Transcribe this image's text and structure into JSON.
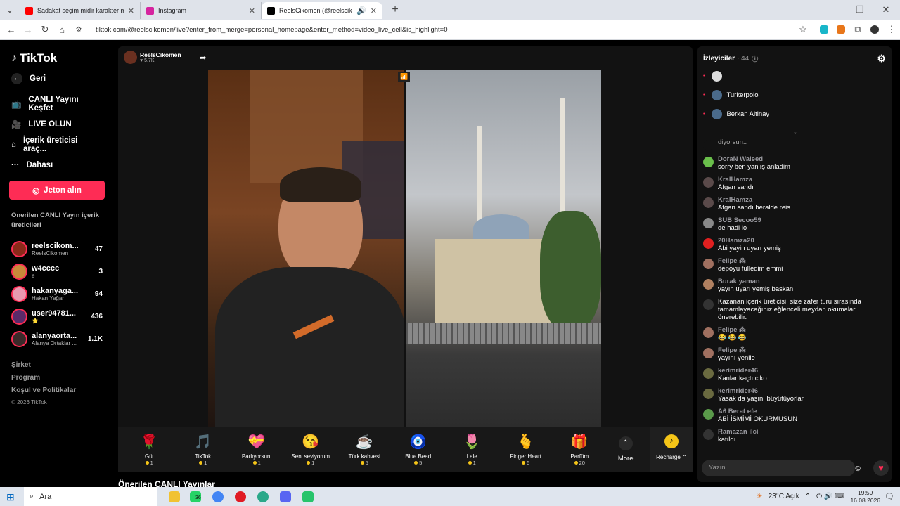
{
  "browser": {
    "tabs": [
      {
        "title": "Sadakat seçim midir karakter mi",
        "color": "#ff0000"
      },
      {
        "title": "Instagram",
        "color": "#d6249f"
      },
      {
        "title": "ReelsCikomen (@reelscikom",
        "color": "#000000"
      }
    ],
    "url": "tiktok.com/@reelscikomen/live?enter_from_merge=personal_homepage&enter_method=video_live_cell&is_highlight=0"
  },
  "nav": {
    "logo": "TikTok",
    "back": "Geri",
    "items": [
      "CANLI Yayını Keşfet",
      "LIVE OLUN",
      "İçerik üreticisi araç...",
      "Dahası"
    ],
    "jeton": "Jeton alın",
    "suggested_title": "Önerilen CANLI Yayın içerik üreticileri",
    "suggested": [
      {
        "name": "reelscikom...",
        "sub": "ReelsCikomen",
        "count": "47",
        "color": "#8a2a1a"
      },
      {
        "name": "w4cccc",
        "sub": "e",
        "count": "3",
        "color": "#c98a3a"
      },
      {
        "name": "hakanyaga...",
        "sub": "Hakan Yağar",
        "count": "94",
        "color": "#e89ab0"
      },
      {
        "name": "user94781...",
        "sub": "⭐",
        "count": "436",
        "color": "#5a2a6a"
      },
      {
        "name": "alanyaorta...",
        "sub": "Alanya Ortaklar ...",
        "count": "1.1K",
        "color": "#3a2a2a"
      }
    ],
    "footer": [
      "Şirket",
      "Program",
      "Koşul ve Politikalar",
      "© 2026 TikTok"
    ]
  },
  "stream": {
    "host": "ReelsCikomen",
    "likes": "5.7K",
    "signal": "📶",
    "gifts": [
      {
        "name": "Gül",
        "price": "1",
        "icon": "🌹"
      },
      {
        "name": "TikTok",
        "price": "1",
        "icon": "🎵"
      },
      {
        "name": "Parlıyorsun!",
        "price": "1",
        "icon": "💝"
      },
      {
        "name": "Seni seviyorum",
        "price": "1",
        "icon": "😘"
      },
      {
        "name": "Türk kahvesi",
        "price": "5",
        "icon": "☕"
      },
      {
        "name": "Blue Bead",
        "price": "5",
        "icon": "🧿"
      },
      {
        "name": "Lale",
        "price": "1",
        "icon": "🌷"
      },
      {
        "name": "Finger Heart",
        "price": "5",
        "icon": "🫰"
      },
      {
        "name": "Parfüm",
        "price": "20",
        "icon": "🎁"
      }
    ],
    "more": "More",
    "recharge": "Recharge ⌃",
    "below_title": "Önerilen CANLI Yayınlar"
  },
  "chat": {
    "viewers_label": "İzleyiciler",
    "viewer_count": "· 44",
    "viewers": [
      "",
      "Turkerpolo",
      "Berkan Altinay"
    ],
    "messages": [
      {
        "user": "",
        "text": "diyorsun..",
        "color": "#121212"
      },
      {
        "user": "DoraN Waleed",
        "text": "sorry ben yanlış anladim",
        "color": "#6abf4b"
      },
      {
        "user": "KralHamza",
        "text": "Afgan sandı",
        "color": "#5a4a4a"
      },
      {
        "user": "KralHamza",
        "text": "Afgan sandı heralde reis",
        "color": "#5a4a4a"
      },
      {
        "user": "SUB Secoo59",
        "text": "de hadi lo",
        "color": "#888"
      },
      {
        "user": "20Hamza20",
        "text": "Abi yayin uyarı yemiş",
        "color": "#e02020"
      },
      {
        "user": "Felipe ⁂",
        "text": "depoyu fulledim emmi",
        "color": "#a07060"
      },
      {
        "user": "Burak yaman",
        "text": "yayın uyarı yemiş baskan",
        "color": "#b08060"
      },
      {
        "user": "",
        "text": "Kazanan içerik üreticisi, size zafer turu sırasında tamamlayacağınız eğlenceli meydan okumalar önerebilir.",
        "color": "#333"
      },
      {
        "user": "Felipe ⁂",
        "text": "😂 😂 😂",
        "color": "#a07060"
      },
      {
        "user": "Felipe ⁂",
        "text": "yayını yenile",
        "color": "#a07060"
      },
      {
        "user": "kerimrider46",
        "text": "Kanlar kaçtı ciko",
        "color": "#6a6a40"
      },
      {
        "user": "kerimrider46",
        "text": "Yasak da yaşını büyütüyorlar",
        "color": "#6a6a40"
      },
      {
        "user": "A6 Berat efe",
        "text": "ABİ İSMİMİ OKURMUSUN",
        "color": "#5a9a4a"
      },
      {
        "user": "Ramazan ilci",
        "text": "katıldı",
        "color": "#333"
      }
    ],
    "input_placeholder": "Yazın..."
  },
  "taskbar": {
    "search": "Ara",
    "weather": "23°C  Açık",
    "time": "19:59",
    "date": "16.08.2026",
    "badge": "36"
  }
}
